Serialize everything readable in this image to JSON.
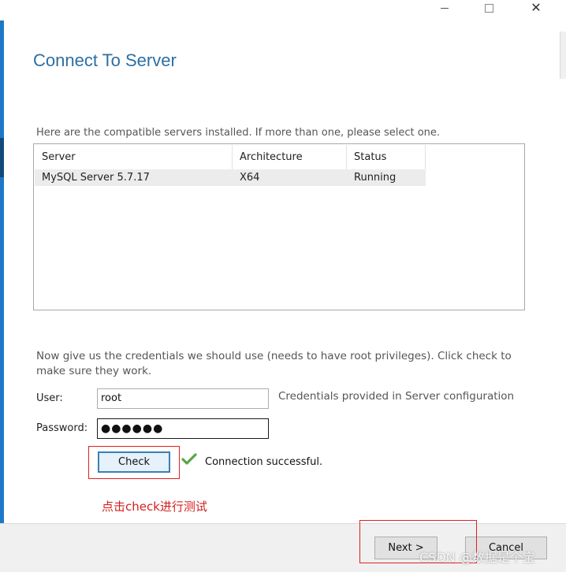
{
  "window": {
    "controls": {
      "minimize_icon": "minimize-icon",
      "maximize_icon": "maximize-icon",
      "close_glyph": "✕"
    }
  },
  "page": {
    "title": "Connect To Server",
    "intro": "Here are the compatible servers installed.  If more than one, please select one."
  },
  "server_list": {
    "columns": [
      "Server",
      "Architecture",
      "Status"
    ],
    "rows": [
      {
        "server": "MySQL Server 5.7.17",
        "architecture": "X64",
        "status": "Running"
      }
    ]
  },
  "credentials": {
    "description": "Now give us the credentials we should use (needs to have root privileges).  Click check to make sure they work.",
    "user_label": "User:",
    "user_value": "root",
    "password_label": "Password:",
    "password_value": "●●●●●●",
    "hint": "Credentials provided in Server configuration",
    "check_label": "Check",
    "status_icon": "checkmark-icon",
    "status_text": "Connection successful."
  },
  "annotation": "点击check进行测试",
  "footer": {
    "next_label": "Next >",
    "cancel_label": "Cancel"
  },
  "watermark": "CSDN @数据是个宝",
  "colors": {
    "title": "#2d6fa3",
    "accent_strip": "#1e78c8",
    "annotation_red": "#d42020",
    "check_green": "#5aa544"
  }
}
